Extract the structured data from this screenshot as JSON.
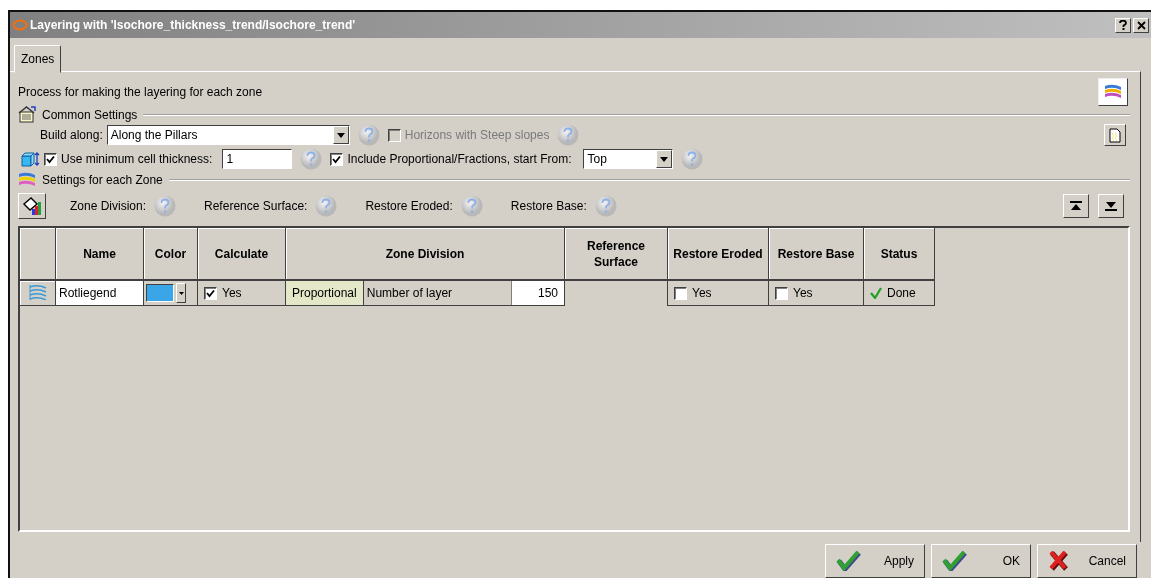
{
  "window": {
    "title": "Layering with 'Isochore_thickness_trend/Isochore_trend'"
  },
  "tabs": [
    {
      "label": "Zones",
      "selected": true
    }
  ],
  "description": "Process for making the layering for each zone",
  "common_settings": {
    "title": "Common Settings",
    "build_along": {
      "label": "Build along:",
      "value": "Along the Pillars"
    },
    "steep_slopes": {
      "label": "Horizons with Steep slopes",
      "checked": false,
      "disabled": true
    },
    "min_thickness": {
      "label": "Use minimum cell thickness:",
      "checked": true,
      "value": "1"
    },
    "proportional": {
      "label": "Include Proportional/Fractions, start From:",
      "checked": true,
      "disabled": false
    },
    "start_from": {
      "value": "Top"
    }
  },
  "zone_settings": {
    "title": "Settings for each Zone",
    "help_labels": [
      "Zone Division:",
      "Reference Surface:",
      "Restore Eroded:",
      "Restore Base:"
    ]
  },
  "table": {
    "columns": [
      "Name",
      "Color",
      "Calculate",
      "Zone Division",
      "Reference Surface",
      "Restore Eroded",
      "Restore Base",
      "Status"
    ],
    "rows": [
      {
        "name": "Rotliegend",
        "color": "#3aa6e8",
        "calculate": {
          "label": "Yes",
          "checked": true
        },
        "division_type": "Proportional",
        "division_label": "Number of layer",
        "division_value": "150",
        "restore_eroded": {
          "label": "Yes",
          "checked": false
        },
        "restore_base": {
          "label": "Yes",
          "checked": false
        },
        "status": "Done"
      }
    ]
  },
  "buttons": [
    {
      "label": "Apply",
      "kind": "check"
    },
    {
      "label": "OK",
      "kind": "check"
    },
    {
      "label": "Cancel",
      "kind": "cross"
    }
  ]
}
